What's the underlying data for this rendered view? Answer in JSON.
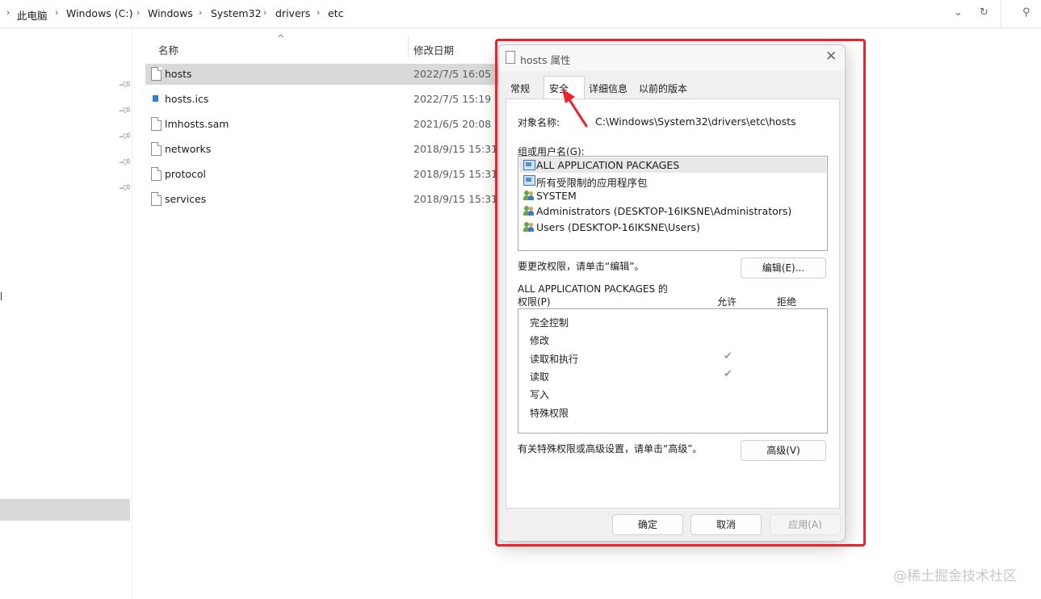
{
  "address_bar": {
    "breadcrumbs": [
      "此电脑",
      "Windows (C:)",
      "Windows",
      "System32",
      "drivers",
      "etc"
    ],
    "dropdown_icon": "chevron-down-icon",
    "refresh_icon": "refresh-icon",
    "search_icon": "search-icon"
  },
  "file_list": {
    "columns": {
      "name": "名称",
      "modified": "修改日期"
    },
    "rows": [
      {
        "name": "hosts",
        "modified": "2022/7/5 16:05",
        "icon": "file-icon",
        "selected": true
      },
      {
        "name": "hosts.ics",
        "modified": "2022/7/5 15:19",
        "icon": "ics-file-icon",
        "selected": false
      },
      {
        "name": "lmhosts.sam",
        "modified": "2021/6/5 20:08",
        "icon": "file-icon",
        "selected": false
      },
      {
        "name": "networks",
        "modified": "2018/9/15 15:31",
        "icon": "file-icon",
        "selected": false
      },
      {
        "name": "protocol",
        "modified": "2018/9/15 15:31",
        "icon": "file-icon",
        "selected": false
      },
      {
        "name": "services",
        "modified": "2018/9/15 15:31",
        "icon": "file-icon",
        "selected": false
      }
    ]
  },
  "dialog": {
    "title": "hosts 属性",
    "tabs": [
      "常规",
      "安全",
      "详细信息",
      "以前的版本"
    ],
    "active_tab": "安全",
    "object_name_label": "对象名称:",
    "object_name_value": "C:\\Windows\\System32\\drivers\\etc\\hosts",
    "groups_label": "组或用户名(G):",
    "groups": [
      {
        "name": "ALL APPLICATION PACKAGES",
        "icon": "package-group-icon",
        "selected": true
      },
      {
        "name": "所有受限制的应用程序包",
        "icon": "package-group-icon",
        "selected": false
      },
      {
        "name": "SYSTEM",
        "icon": "users-icon",
        "selected": false
      },
      {
        "name": "Administrators (DESKTOP-16IKSNE\\Administrators)",
        "icon": "users-icon",
        "selected": false
      },
      {
        "name": "Users (DESKTOP-16IKSNE\\Users)",
        "icon": "users-icon",
        "selected": false
      }
    ],
    "change_hint": "要更改权限，请单击“编辑”。",
    "edit_button": "编辑(E)...",
    "permissions_for_line1": "ALL APPLICATION PACKAGES 的",
    "permissions_for_line2": "权限(P)",
    "allow_header": "允许",
    "deny_header": "拒绝",
    "permissions": [
      {
        "name": "完全控制",
        "allow": false,
        "deny": false
      },
      {
        "name": "修改",
        "allow": false,
        "deny": false
      },
      {
        "name": "读取和执行",
        "allow": true,
        "deny": false
      },
      {
        "name": "读取",
        "allow": true,
        "deny": false
      },
      {
        "name": "写入",
        "allow": false,
        "deny": false
      },
      {
        "name": "特殊权限",
        "allow": false,
        "deny": false
      }
    ],
    "advanced_hint": "有关特殊权限或高级设置，请单击“高级”。",
    "advanced_button": "高级(V)",
    "ok_button": "确定",
    "cancel_button": "取消",
    "apply_button": "应用(A)"
  },
  "annotation_color": "#e8232c",
  "watermark": "@稀土掘金技术社区"
}
